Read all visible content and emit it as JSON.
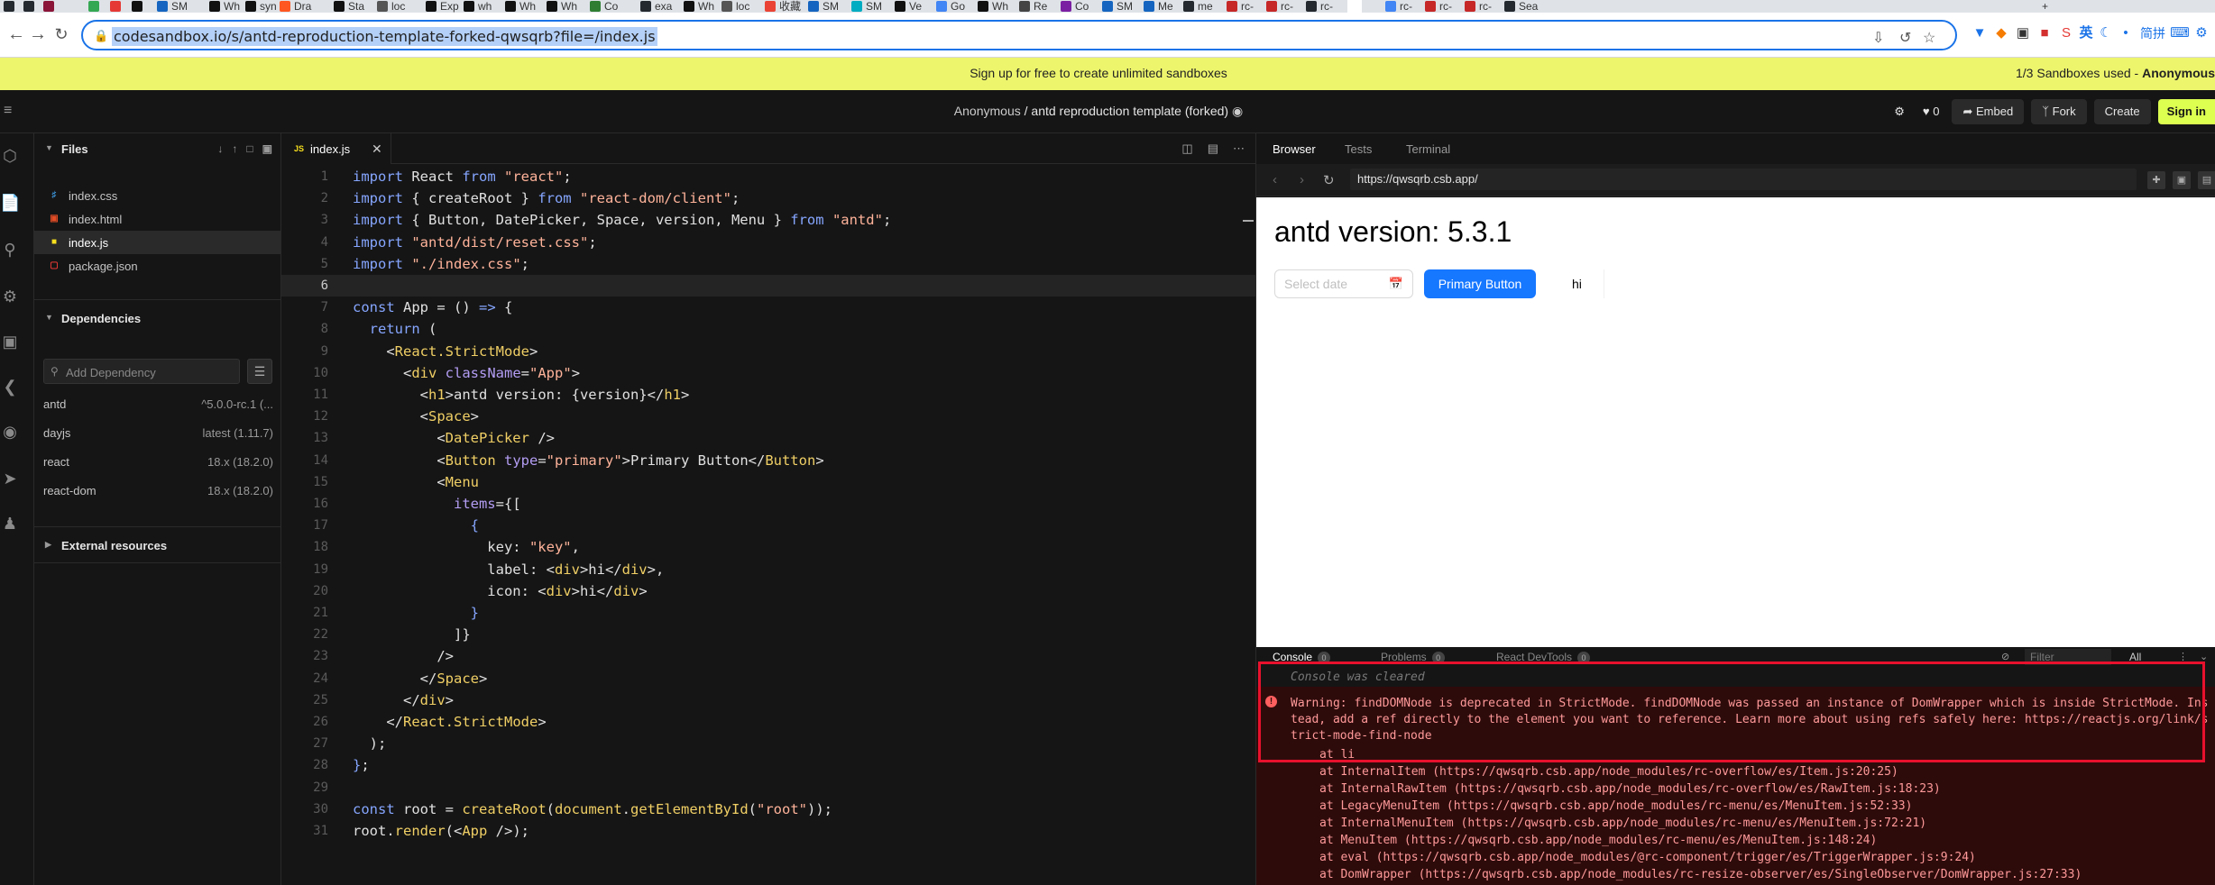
{
  "browser": {
    "tabs": [
      {
        "label": "",
        "color": "#24292f"
      },
      {
        "label": "",
        "color": "#24292f"
      },
      {
        "label": "",
        "color": "#8a1538"
      },
      {
        "label": "",
        "color": "#34a853"
      },
      {
        "label": "",
        "color": "#e53935"
      },
      {
        "label": "",
        "color": "#111111"
      },
      {
        "label": "SM",
        "color": "#1565c0"
      },
      {
        "label": "Wh",
        "color": "#111111"
      },
      {
        "label": "syn",
        "color": "#111111"
      },
      {
        "label": "Dra",
        "color": "#ff5722"
      },
      {
        "label": "Sta",
        "color": "#111111"
      },
      {
        "label": "loc",
        "color": "#555555"
      },
      {
        "label": "Exp",
        "color": "#111111"
      },
      {
        "label": "wh",
        "color": "#111111"
      },
      {
        "label": "Wh",
        "color": "#111111"
      },
      {
        "label": "Wh",
        "color": "#111111"
      },
      {
        "label": "Co",
        "color": "#2e7d32"
      },
      {
        "label": "exa",
        "color": "#24292f"
      },
      {
        "label": "Wh",
        "color": "#111111"
      },
      {
        "label": "loc",
        "color": "#555555"
      },
      {
        "label": "收藏",
        "color": "#ea4335"
      },
      {
        "label": "SM",
        "color": "#1565c0"
      },
      {
        "label": "SM",
        "color": "#00acc1"
      },
      {
        "label": "Ve",
        "color": "#111111"
      },
      {
        "label": "Go",
        "color": "#4285f4"
      },
      {
        "label": "Wh",
        "color": "#111111"
      },
      {
        "label": "Re",
        "color": "#444444"
      },
      {
        "label": "Co",
        "color": "#7b1fa2"
      },
      {
        "label": "SM",
        "color": "#1565c0"
      },
      {
        "label": "Me",
        "color": "#1565c0"
      },
      {
        "label": "me",
        "color": "#24292f"
      },
      {
        "label": "rc-",
        "color": "#c62828"
      },
      {
        "label": "rc-",
        "color": "#c62828"
      },
      {
        "label": "rc-",
        "color": "#24292f"
      },
      {
        "label": "",
        "color": "#ffffff"
      },
      {
        "label": "rc-",
        "color": "#4285f4"
      },
      {
        "label": "rc-",
        "color": "#c62828"
      },
      {
        "label": "rc-",
        "color": "#c62828"
      },
      {
        "label": "Sea",
        "color": "#24292f"
      }
    ],
    "new_tab": "+",
    "url": "codesandbox.io/s/antd-reproduction-template-forked-qwsqrb?file=/index.js",
    "ime": "英",
    "ime_extra": "简拼"
  },
  "banner": {
    "message": "Sign up for free to create unlimited sandboxes",
    "used_prefix": "1/3 Sandboxes used - ",
    "used_user": "Anonymous"
  },
  "header": {
    "owner": "Anonymous",
    "separator": " / ",
    "sandbox_name": "antd reproduction template (forked)",
    "likes": "0",
    "embed": "Embed",
    "fork": "Fork",
    "create": "Create",
    "sign_in": "Sign in"
  },
  "sidebar": {
    "files_title": "Files",
    "files": [
      {
        "name": "index.css",
        "icon": "css",
        "color": "#42a5f5"
      },
      {
        "name": "index.html",
        "icon": "html",
        "color": "#e44d26"
      },
      {
        "name": "index.js",
        "icon": "js",
        "color": "#f7df1e"
      },
      {
        "name": "package.json",
        "icon": "json",
        "color": "#e53935"
      }
    ],
    "deps_title": "Dependencies",
    "dep_placeholder": "Add Dependency",
    "dependencies": [
      {
        "name": "antd",
        "version": "^5.0.0-rc.1 (..."
      },
      {
        "name": "dayjs",
        "version": "latest (1.11.7)"
      },
      {
        "name": "react",
        "version": "18.x (18.2.0)"
      },
      {
        "name": "react-dom",
        "version": "18.x (18.2.0)"
      }
    ],
    "external_title": "External resources"
  },
  "editor": {
    "tab_label": "index.js",
    "tab_icon": "JS",
    "current_line": 6
  },
  "preview": {
    "tabs": [
      "Browser",
      "Tests",
      "Terminal"
    ],
    "url": "https://qwsqrb.csb.app/",
    "heading": "antd version: 5.3.1",
    "date_placeholder": "Select date",
    "primary_button": "Primary Button",
    "menu_item": "hi"
  },
  "console": {
    "tabs": [
      {
        "label": "Console",
        "count": "0"
      },
      {
        "label": "Problems",
        "count": "0"
      },
      {
        "label": "React DevTools",
        "count": "0"
      }
    ],
    "filter_placeholder": "Filter",
    "level": "All",
    "cleared": "Console was cleared",
    "warning": "Warning: findDOMNode is deprecated in StrictMode. findDOMNode was passed an instance of DomWrapper which is inside StrictMode. Instead, add a ref directly to the element you want to reference. Learn more about using refs safely here: https://reactjs.org/link/strict-mode-find-node",
    "stack": [
      "at li",
      "at InternalItem (https://qwsqrb.csb.app/node_modules/rc-overflow/es/Item.js:20:25)",
      "at InternalRawItem (https://qwsqrb.csb.app/node_modules/rc-overflow/es/RawItem.js:18:23)",
      "at LegacyMenuItem (https://qwsqrb.csb.app/node_modules/rc-menu/es/MenuItem.js:52:33)",
      "at InternalMenuItem (https://qwsqrb.csb.app/node_modules/rc-menu/es/MenuItem.js:72:21)",
      "at MenuItem (https://qwsqrb.csb.app/node_modules/rc-menu/es/MenuItem.js:148:24)",
      "at eval (https://qwsqrb.csb.app/node_modules/@rc-component/trigger/es/TriggerWrapper.js:9:24)",
      "at DomWrapper (https://qwsqrb.csb.app/node_modules/rc-resize-observer/es/SingleObserver/DomWrapper.js:27:33)"
    ]
  },
  "code": [
    [
      [
        "kw",
        "import"
      ],
      [
        "pn",
        " React "
      ],
      [
        "kw",
        "from"
      ],
      [
        "pn",
        " "
      ],
      [
        "st",
        "\"react\""
      ],
      [
        "pn",
        ";"
      ]
    ],
    [
      [
        "kw",
        "import"
      ],
      [
        "pn",
        " { createRoot } "
      ],
      [
        "kw",
        "from"
      ],
      [
        "pn",
        " "
      ],
      [
        "st",
        "\"react-dom/client\""
      ],
      [
        "pn",
        ";"
      ]
    ],
    [
      [
        "kw",
        "import"
      ],
      [
        "pn",
        " { Button, DatePicker, Space, version, Menu } "
      ],
      [
        "kw",
        "from"
      ],
      [
        "pn",
        " "
      ],
      [
        "st",
        "\"antd\""
      ],
      [
        "pn",
        ";"
      ]
    ],
    [
      [
        "kw",
        "import"
      ],
      [
        "pn",
        " "
      ],
      [
        "st",
        "\"antd/dist/reset.css\""
      ],
      [
        "pn",
        ";"
      ]
    ],
    [
      [
        "kw",
        "import"
      ],
      [
        "pn",
        " "
      ],
      [
        "st",
        "\"./index.css\""
      ],
      [
        "pn",
        ";"
      ]
    ],
    [],
    [
      [
        "kw",
        "const"
      ],
      [
        "pn",
        " App = () "
      ],
      [
        "ar",
        "=>"
      ],
      [
        "pn",
        " {"
      ]
    ],
    [
      [
        "pn",
        "  "
      ],
      [
        "kw",
        "return"
      ],
      [
        "pn",
        " ("
      ]
    ],
    [
      [
        "pn",
        "    <"
      ],
      [
        "tg",
        "React.StrictMode"
      ],
      [
        "pn",
        ">"
      ]
    ],
    [
      [
        "pn",
        "      <"
      ],
      [
        "tg",
        "div"
      ],
      [
        "pn",
        " "
      ],
      [
        "at",
        "className"
      ],
      [
        "pn",
        "="
      ],
      [
        "st",
        "\"App\""
      ],
      [
        "pn",
        ">"
      ]
    ],
    [
      [
        "pn",
        "        <"
      ],
      [
        "tg",
        "h1"
      ],
      [
        "pn",
        ">antd version: {version}</"
      ],
      [
        "tg",
        "h1"
      ],
      [
        "pn",
        ">"
      ]
    ],
    [
      [
        "pn",
        "        <"
      ],
      [
        "tg",
        "Space"
      ],
      [
        "pn",
        ">"
      ]
    ],
    [
      [
        "pn",
        "          <"
      ],
      [
        "tg",
        "DatePicker"
      ],
      [
        "pn",
        " />"
      ]
    ],
    [
      [
        "pn",
        "          <"
      ],
      [
        "tg",
        "Button"
      ],
      [
        "pn",
        " "
      ],
      [
        "at",
        "type"
      ],
      [
        "pn",
        "="
      ],
      [
        "st",
        "\"primary\""
      ],
      [
        "pn",
        ">Primary Button</"
      ],
      [
        "tg",
        "Button"
      ],
      [
        "pn",
        ">"
      ]
    ],
    [
      [
        "pn",
        "          <"
      ],
      [
        "tg",
        "Menu"
      ]
    ],
    [
      [
        "pn",
        "            "
      ],
      [
        "at",
        "items"
      ],
      [
        "pn",
        "={["
      ]
    ],
    [
      [
        "pn",
        "              "
      ],
      [
        "kw",
        "{"
      ]
    ],
    [
      [
        "pn",
        "                key: "
      ],
      [
        "st",
        "\"key\""
      ],
      [
        "pn",
        ","
      ]
    ],
    [
      [
        "pn",
        "                label: <"
      ],
      [
        "tg",
        "div"
      ],
      [
        "pn",
        ">hi</"
      ],
      [
        "tg",
        "div"
      ],
      [
        "pn",
        ">,"
      ]
    ],
    [
      [
        "pn",
        "                icon: <"
      ],
      [
        "tg",
        "div"
      ],
      [
        "pn",
        ">hi</"
      ],
      [
        "tg",
        "div"
      ],
      [
        "pn",
        ">"
      ]
    ],
    [
      [
        "pn",
        "              "
      ],
      [
        "kw",
        "}"
      ]
    ],
    [
      [
        "pn",
        "            ]}"
      ]
    ],
    [
      [
        "pn",
        "          />"
      ]
    ],
    [
      [
        "pn",
        "        </"
      ],
      [
        "tg",
        "Space"
      ],
      [
        "pn",
        ">"
      ]
    ],
    [
      [
        "pn",
        "      </"
      ],
      [
        "tg",
        "div"
      ],
      [
        "pn",
        ">"
      ]
    ],
    [
      [
        "pn",
        "    </"
      ],
      [
        "tg",
        "React.StrictMode"
      ],
      [
        "pn",
        ">"
      ]
    ],
    [
      [
        "pn",
        "  );"
      ]
    ],
    [
      [
        "kw",
        "}"
      ],
      [
        "pn",
        ";"
      ]
    ],
    [],
    [
      [
        "kw",
        "const"
      ],
      [
        "pn",
        " root = "
      ],
      [
        "fn",
        "createRoot"
      ],
      [
        "pn",
        "("
      ],
      [
        "fn",
        "document"
      ],
      [
        "pn",
        "."
      ],
      [
        "fn",
        "getElementById"
      ],
      [
        "pn",
        "("
      ],
      [
        "st",
        "\"root\""
      ],
      [
        "pn",
        "));"
      ]
    ],
    [
      [
        "pn",
        "root."
      ],
      [
        "fn",
        "render"
      ],
      [
        "pn",
        "(<"
      ],
      [
        "tg",
        "App"
      ],
      [
        "pn",
        " />);"
      ]
    ]
  ]
}
